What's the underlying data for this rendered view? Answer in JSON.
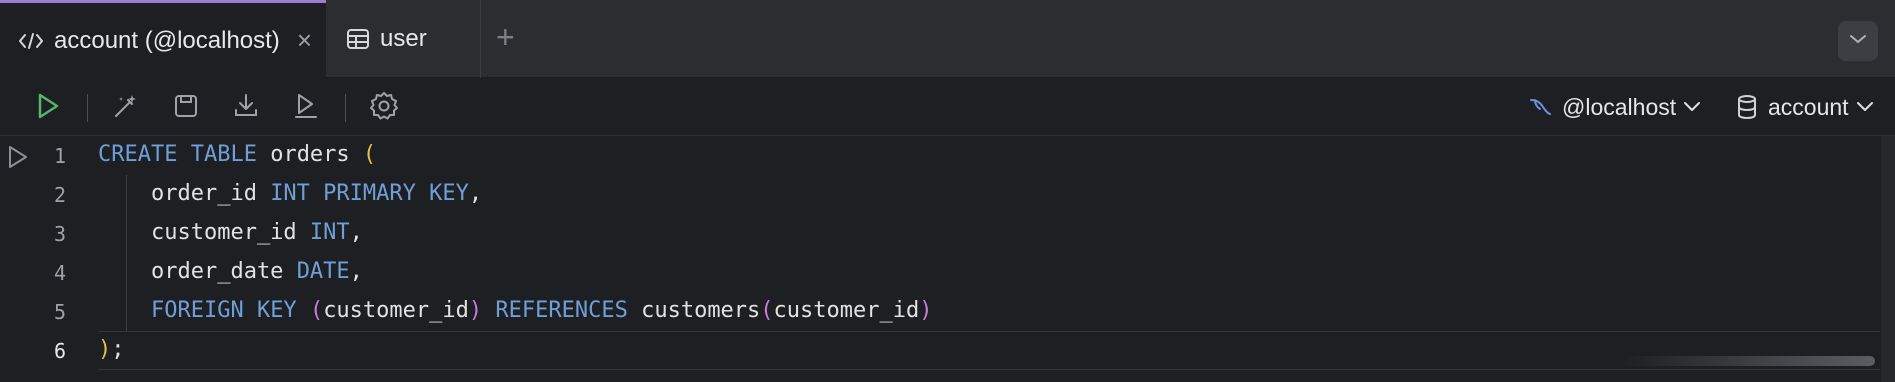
{
  "tabs": [
    {
      "label": "account (@localhost)",
      "icon": "code-icon",
      "active": true,
      "close": "×"
    },
    {
      "label": "user",
      "icon": "table-icon",
      "active": false
    }
  ],
  "new_tab_label": "+",
  "toolbar": {
    "connection": "@localhost",
    "database": "account"
  },
  "editor": {
    "line_numbers": [
      "1",
      "2",
      "3",
      "4",
      "5",
      "6"
    ],
    "lines": [
      [
        {
          "t": "CREATE TABLE",
          "c": "kw"
        },
        {
          "t": " orders ",
          "c": ""
        },
        {
          "t": "(",
          "c": "p1"
        }
      ],
      [
        {
          "t": "    order_id ",
          "c": ""
        },
        {
          "t": "INT PRIMARY KEY",
          "c": "kw"
        },
        {
          "t": ",",
          "c": ""
        }
      ],
      [
        {
          "t": "    customer_id ",
          "c": ""
        },
        {
          "t": "INT",
          "c": "kw"
        },
        {
          "t": ",",
          "c": ""
        }
      ],
      [
        {
          "t": "    order_date ",
          "c": ""
        },
        {
          "t": "DATE",
          "c": "kw"
        },
        {
          "t": ",",
          "c": ""
        }
      ],
      [
        {
          "t": "    ",
          "c": ""
        },
        {
          "t": "FOREIGN KEY",
          "c": "kw"
        },
        {
          "t": " ",
          "c": ""
        },
        {
          "t": "(",
          "c": "p2"
        },
        {
          "t": "customer_id",
          "c": ""
        },
        {
          "t": ")",
          "c": "p2"
        },
        {
          "t": " ",
          "c": ""
        },
        {
          "t": "REFERENCES",
          "c": "kw"
        },
        {
          "t": " customers",
          "c": ""
        },
        {
          "t": "(",
          "c": "p2"
        },
        {
          "t": "customer_id",
          "c": ""
        },
        {
          "t": ")",
          "c": "p2"
        }
      ],
      [
        {
          "t": ")",
          "c": "p1"
        },
        {
          "t": ";",
          "c": ""
        }
      ]
    ]
  },
  "colors": {
    "keyword": "#6f9fd8",
    "paren_level1": "#e0c050",
    "paren_level2": "#c77ddb",
    "active_tab_accent": "#9b7fd4",
    "run_icon": "#4fb86a"
  }
}
